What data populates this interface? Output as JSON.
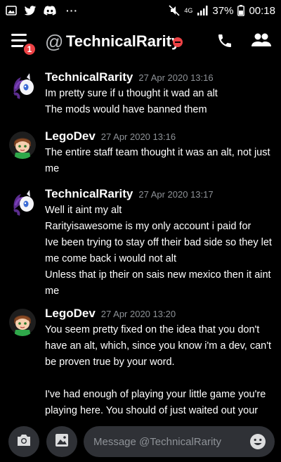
{
  "status_bar": {
    "left_icons": [
      "gallery-icon",
      "twitter-icon",
      "discord-icon"
    ],
    "more": "···",
    "network": "4G",
    "battery": "37%",
    "time": "00:18"
  },
  "header": {
    "notification_count": "1",
    "at_symbol": "@",
    "channel_name": "TechnicalRarity",
    "status": "do-not-disturb",
    "icons": [
      "phone-icon",
      "members-icon"
    ]
  },
  "messages": [
    {
      "author": "TechnicalRarity",
      "timestamp": "27 Apr 2020 13:16",
      "avatar": "rarity-avatar",
      "lines": [
        "Im pretty sure if u thought it wad an alt",
        "The mods would have banned them"
      ]
    },
    {
      "author": "LegoDev",
      "timestamp": "27 Apr 2020 13:16",
      "avatar": "legodev-avatar",
      "lines": [
        "The entire staff team thought it was an alt, not just",
        "me"
      ]
    },
    {
      "author": "TechnicalRarity",
      "timestamp": "27 Apr 2020 13:17",
      "avatar": "rarity-avatar",
      "lines": [
        "Well it aint my alt",
        "Rarityisawesome is my only account i paid for",
        "Ive been trying to stay off their bad side so they let",
        "me come back i would not alt",
        "Unless that ip their on sais new mexico then it aint",
        "me"
      ]
    },
    {
      "author": "LegoDev",
      "timestamp": "27 Apr 2020 13:20",
      "avatar": "legodev-avatar",
      "lines": [
        "You seem pretty fixed on the idea that you don't",
        "have an alt, which, since you know i'm a dev, can't",
        "be proven true by your word.",
        "",
        "I've had enough of playing your little game you're",
        "playing here. You should of just waited out your"
      ]
    }
  ],
  "input": {
    "placeholder": "Message @TechnicalRarity"
  },
  "colors": {
    "background": "#000000",
    "badge": "#ed4245",
    "input_bg": "#2f3136",
    "timestamp": "#8e9297"
  }
}
